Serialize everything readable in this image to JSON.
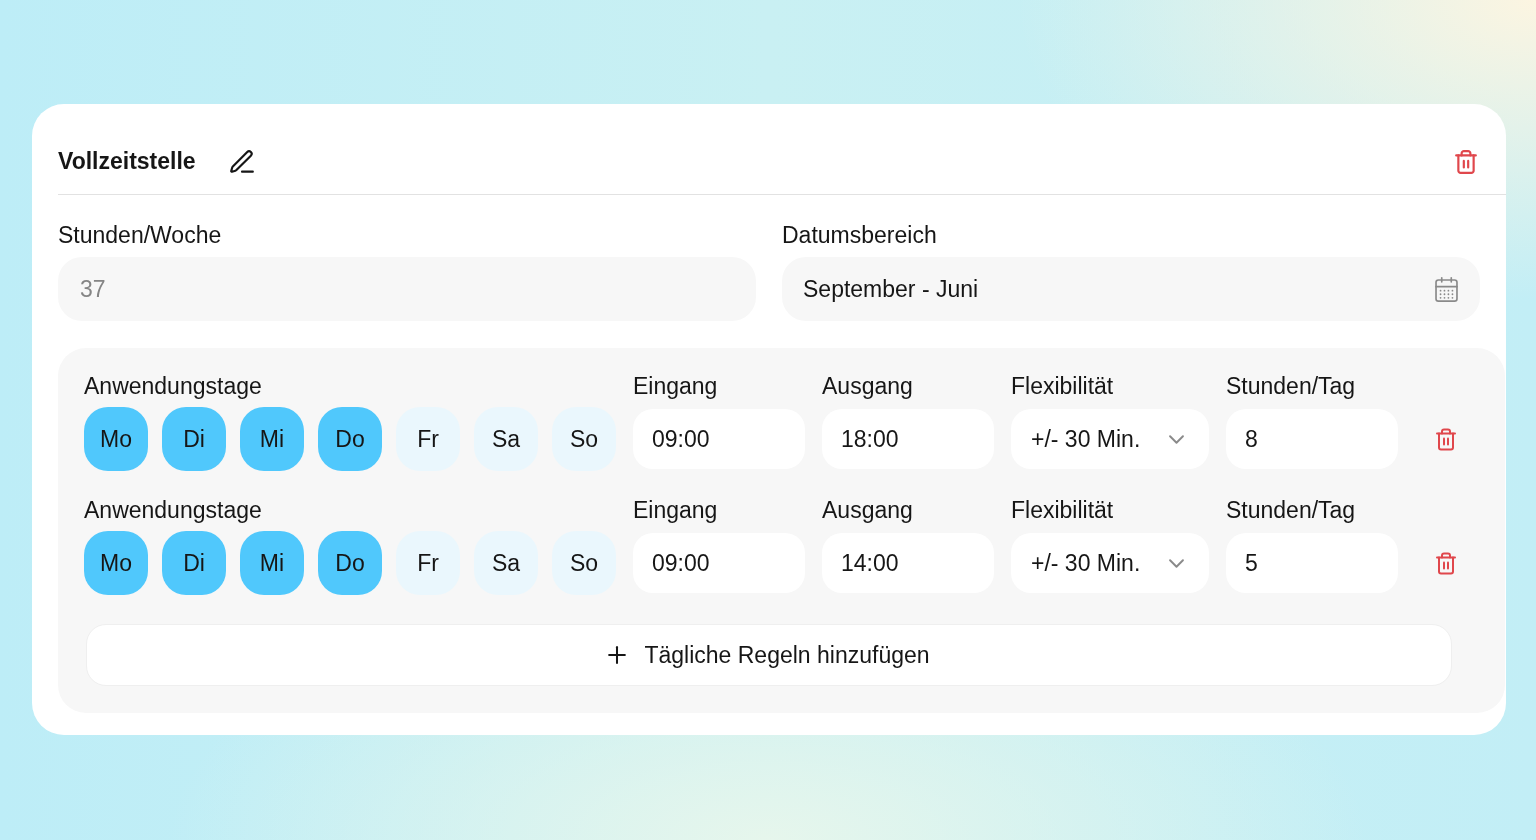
{
  "card": {
    "title": "Vollzeitstelle"
  },
  "fields": [
    {
      "label": "Stunden/Woche",
      "kind": "text",
      "placeholder": "37"
    },
    {
      "label": "Datumsbereich",
      "kind": "date",
      "value": "September - Juni"
    }
  ],
  "rules": [
    {
      "days_label": "Anwendungstage",
      "days": [
        {
          "label": "Mo",
          "selected": true
        },
        {
          "label": "Di",
          "selected": true
        },
        {
          "label": "Mi",
          "selected": true
        },
        {
          "label": "Do",
          "selected": true
        },
        {
          "label": "Fr",
          "selected": false
        },
        {
          "label": "Sa",
          "selected": false
        },
        {
          "label": "So",
          "selected": false
        }
      ],
      "columns": [
        {
          "label": "Eingang",
          "kind": "text",
          "value": "09:00"
        },
        {
          "label": "Ausgang",
          "kind": "text",
          "value": "18:00"
        },
        {
          "label": "Flexibilität",
          "kind": "select",
          "value": "+/- 30 Min."
        },
        {
          "label": "Stunden/Tag",
          "kind": "text",
          "value": "8"
        }
      ]
    },
    {
      "days_label": "Anwendungstage",
      "days": [
        {
          "label": "Mo",
          "selected": true
        },
        {
          "label": "Di",
          "selected": true
        },
        {
          "label": "Mi",
          "selected": true
        },
        {
          "label": "Do",
          "selected": true
        },
        {
          "label": "Fr",
          "selected": false
        },
        {
          "label": "Sa",
          "selected": false
        },
        {
          "label": "So",
          "selected": false
        }
      ],
      "columns": [
        {
          "label": "Eingang",
          "kind": "text",
          "value": "09:00"
        },
        {
          "label": "Ausgang",
          "kind": "text",
          "value": "14:00"
        },
        {
          "label": "Flexibilität",
          "kind": "select",
          "value": "+/- 30 Min."
        },
        {
          "label": "Stunden/Tag",
          "kind": "text",
          "value": "5"
        }
      ]
    }
  ],
  "add_button": {
    "label": "Tägliche Regeln hinzufügen"
  }
}
